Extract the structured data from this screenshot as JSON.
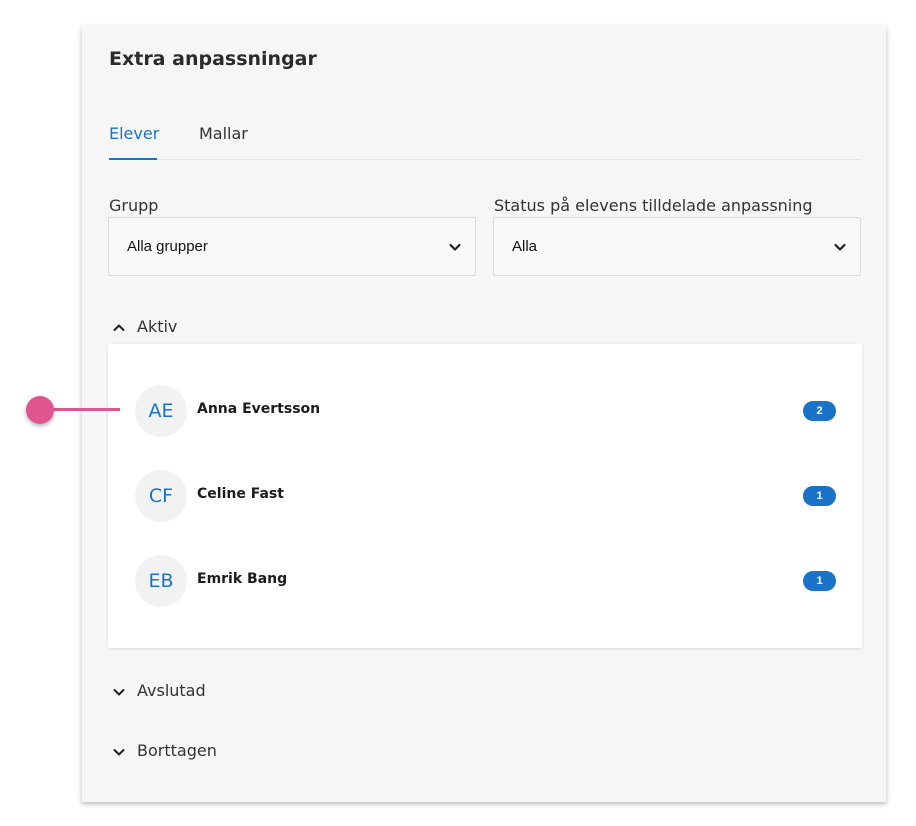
{
  "panel": {
    "title": "Extra anpassningar",
    "tabs": [
      {
        "label": "Elever",
        "active": true
      },
      {
        "label": "Mallar",
        "active": false
      }
    ]
  },
  "filters": {
    "group": {
      "label": "Grupp",
      "value": "Alla grupper"
    },
    "status": {
      "label": "Status på elevens tilldelade anpassning",
      "value": "Alla"
    }
  },
  "sections": {
    "active": {
      "label": "Aktiv",
      "expanded": true,
      "students": [
        {
          "initials": "AE",
          "name": "Anna Evertsson",
          "count": "2"
        },
        {
          "initials": "CF",
          "name": "Celine Fast",
          "count": "1"
        },
        {
          "initials": "EB",
          "name": "Emrik Bang",
          "count": "1"
        }
      ]
    },
    "finished": {
      "label": "Avslutad",
      "expanded": false
    },
    "removed": {
      "label": "Borttagen",
      "expanded": false
    }
  },
  "icons": {
    "chevron_down": "chevron-down-icon",
    "chevron_up": "chevron-up-icon"
  },
  "colors": {
    "accent": "#1a73c8",
    "callout": "#e0548f"
  }
}
